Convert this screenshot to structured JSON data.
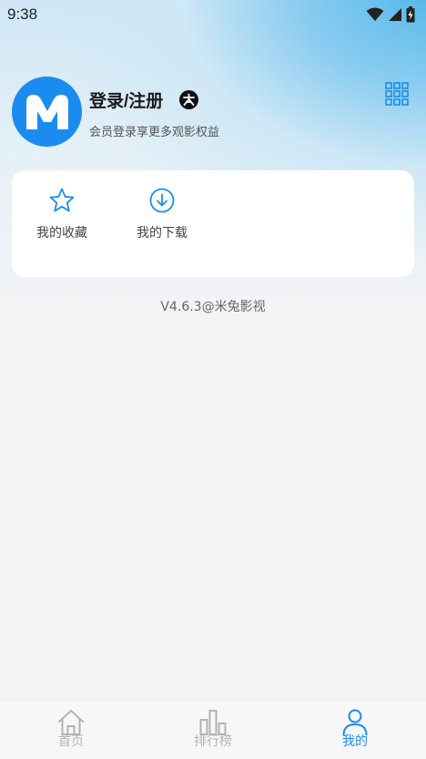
{
  "status_bar": {
    "time": "9:38"
  },
  "profile": {
    "login_label": "登录/注册",
    "subtitle": "会员登录享更多观影权益"
  },
  "card": {
    "items": [
      {
        "label": "我的收藏",
        "icon": "star-icon"
      },
      {
        "label": "我的下载",
        "icon": "download-icon"
      }
    ]
  },
  "version": "V4.6.3@米兔影视",
  "tabbar": {
    "tabs": [
      {
        "label": "首页",
        "icon": "home-icon",
        "active": false
      },
      {
        "label": "排行榜",
        "icon": "bar-chart-icon",
        "active": false
      },
      {
        "label": "我的",
        "icon": "user-icon",
        "active": true
      }
    ]
  },
  "colors": {
    "accent": "#1a8cf0",
    "inactive": "#b3b3b3",
    "card": "#ffffff"
  }
}
